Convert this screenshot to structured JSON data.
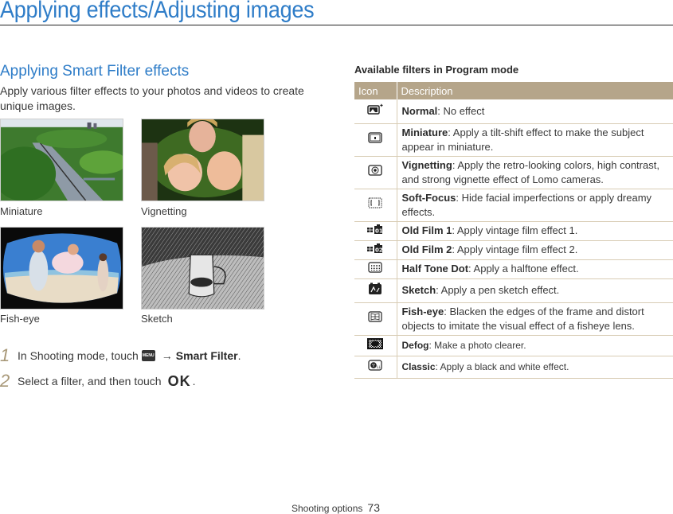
{
  "header": {
    "title": "Applying effects/Adjusting images"
  },
  "section": {
    "title": "Applying Smart Filter effects",
    "intro": "Apply various filter effects to your photos and videos to create unique images."
  },
  "examples": [
    {
      "caption": "Miniature"
    },
    {
      "caption": "Vignetting"
    },
    {
      "caption": "Fish-eye"
    },
    {
      "caption": "Sketch"
    }
  ],
  "steps": [
    {
      "number": "1",
      "text_before": "In Shooting mode, touch",
      "icon": "menu-icon",
      "icon_text": "MENU",
      "arrow": "→",
      "bold": "Smart Filter",
      "text_after": "."
    },
    {
      "number": "2",
      "text_before": "Select a filter, and then touch",
      "icon": "ok-icon",
      "icon_text": "OK",
      "text_after": "."
    }
  ],
  "table": {
    "title": "Available filters in Program mode",
    "headers": {
      "icon": "Icon",
      "description": "Description"
    },
    "rows": [
      {
        "icon": "normal-icon",
        "name": "Normal",
        "desc": ": No effect"
      },
      {
        "icon": "miniature-icon",
        "name": "Miniature",
        "desc": ": Apply a tilt-shift effect to make the subject appear in miniature."
      },
      {
        "icon": "vignetting-icon",
        "name": "Vignetting",
        "desc": ": Apply the retro-looking colors, high contrast, and strong vignette effect of Lomo cameras."
      },
      {
        "icon": "soft-focus-icon",
        "name": "Soft-Focus",
        "desc": ": Hide facial imperfections or apply dreamy effects."
      },
      {
        "icon": "old-film-1-icon",
        "name": "Old Film 1",
        "desc": ": Apply vintage film effect 1."
      },
      {
        "icon": "old-film-2-icon",
        "name": "Old Film 2",
        "desc": ": Apply vintage film effect 2."
      },
      {
        "icon": "half-tone-dot-icon",
        "name": "Half Tone Dot",
        "desc": ": Apply a halftone effect."
      },
      {
        "icon": "sketch-icon",
        "name": "Sketch",
        "desc": ": Apply a pen sketch effect."
      },
      {
        "icon": "fish-eye-icon",
        "name": "Fish-eye",
        "desc": ": Blacken the edges of the frame and distort objects to imitate the visual effect of a fisheye lens."
      },
      {
        "icon": "defog-icon",
        "name": "Defog",
        "desc": ": Make a photo clearer."
      },
      {
        "icon": "classic-icon",
        "name": "Classic",
        "desc": ": Apply a black and white effect."
      }
    ]
  },
  "footer": {
    "section": "Shooting options",
    "page": "73"
  },
  "colors": {
    "title_blue": "#2f7dc8",
    "table_header": "#b5a58a",
    "step_number": "#a89878"
  }
}
